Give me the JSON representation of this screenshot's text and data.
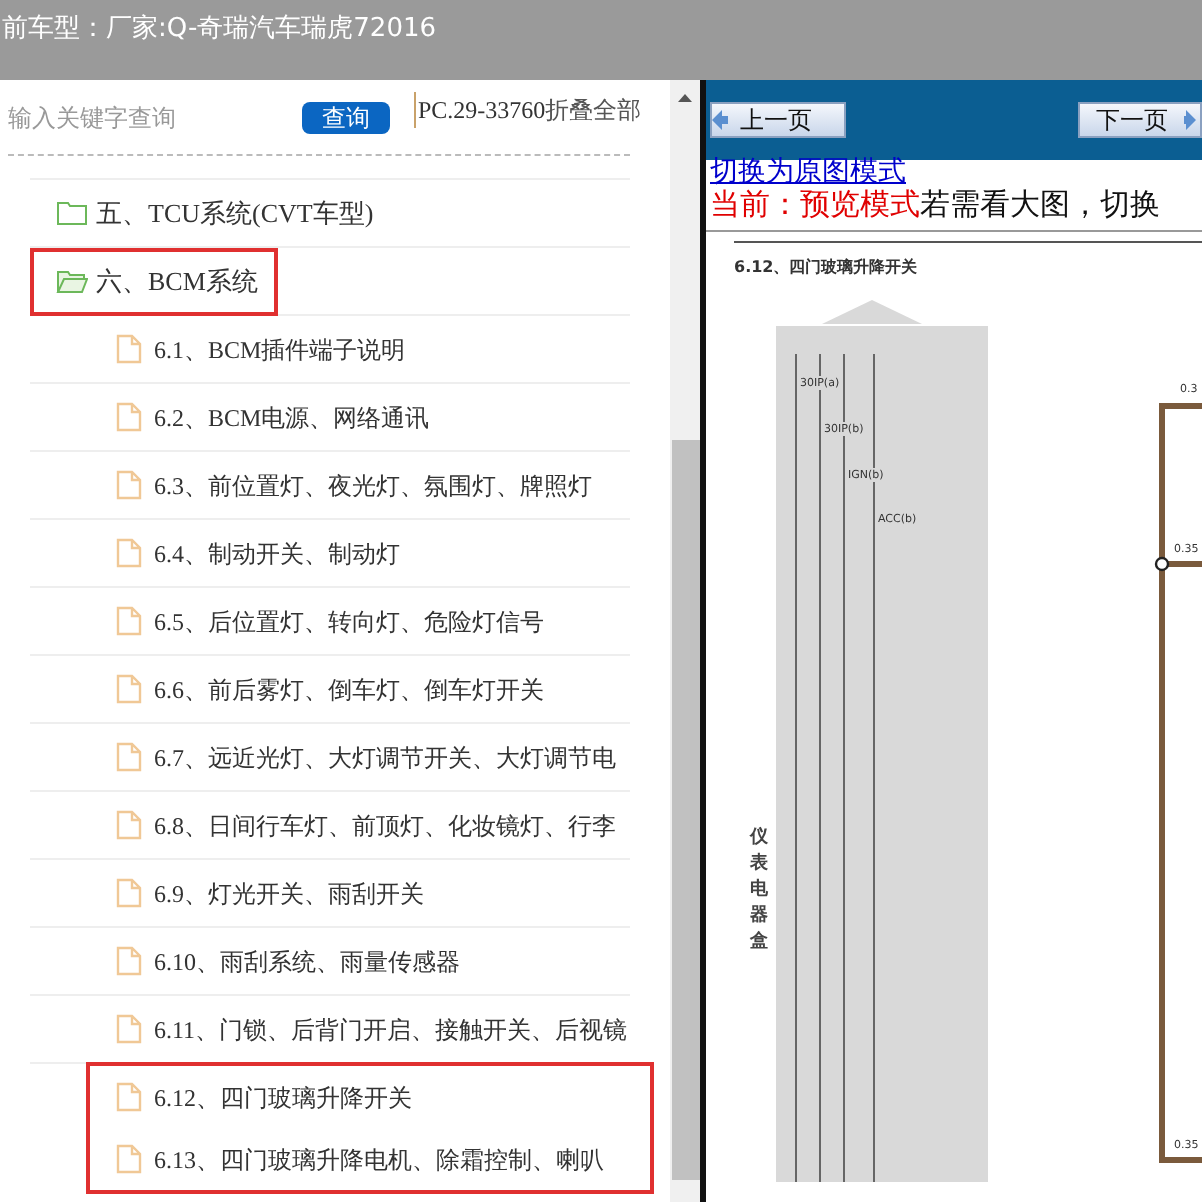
{
  "header": {
    "title": "前车型：厂家:Q-奇瑞汽车瑞虎72016"
  },
  "search": {
    "placeholder": "输入关键字查询",
    "button": "查询",
    "info": "PC.29-33760",
    "collapse_link": "折叠全部"
  },
  "tree": [
    {
      "label": "五、TCU系统(CVT车型)",
      "expanded": false,
      "highlighted": false
    },
    {
      "label": "六、BCM系统",
      "expanded": true,
      "highlighted": true,
      "children": [
        {
          "label": "6.1、BCM插件端子说明",
          "highlighted": false
        },
        {
          "label": "6.2、BCM电源、网络通讯",
          "highlighted": false
        },
        {
          "label": "6.3、前位置灯、夜光灯、氛围灯、牌照灯",
          "highlighted": false
        },
        {
          "label": "6.4、制动开关、制动灯",
          "highlighted": false
        },
        {
          "label": "6.5、后位置灯、转向灯、危险灯信号",
          "highlighted": false
        },
        {
          "label": "6.6、前后雾灯、倒车灯、倒车灯开关",
          "highlighted": false
        },
        {
          "label": "6.7、远近光灯、大灯调节开关、大灯调节电",
          "highlighted": false
        },
        {
          "label": "6.8、日间行车灯、前顶灯、化妆镜灯、行李",
          "highlighted": false
        },
        {
          "label": "6.9、灯光开关、雨刮开关",
          "highlighted": false
        },
        {
          "label": "6.10、雨刮系统、雨量传感器",
          "highlighted": false
        },
        {
          "label": "6.11、门锁、后背门开启、接触开关、后视镜",
          "highlighted": false
        },
        {
          "label": "6.12、四门玻璃升降开关",
          "highlighted": true
        },
        {
          "label": "6.13、四门玻璃升降电机、除霜控制、喇叭",
          "highlighted": true
        }
      ]
    }
  ],
  "nav": {
    "prev": "上一页",
    "next": "下一页"
  },
  "mode": {
    "link": "切换为原图模式",
    "current": "当前：预览模式",
    "hint": "若需看大图，切换"
  },
  "diagram": {
    "title": "6.12、四门玻璃升降开关",
    "signals": [
      "30IP(a)",
      "30IP(b)",
      "IGN(b)",
      "ACC(b)"
    ],
    "box_label": "仪表电器盒",
    "wire_labels": [
      "0.3",
      "0.35",
      "0.35"
    ]
  }
}
